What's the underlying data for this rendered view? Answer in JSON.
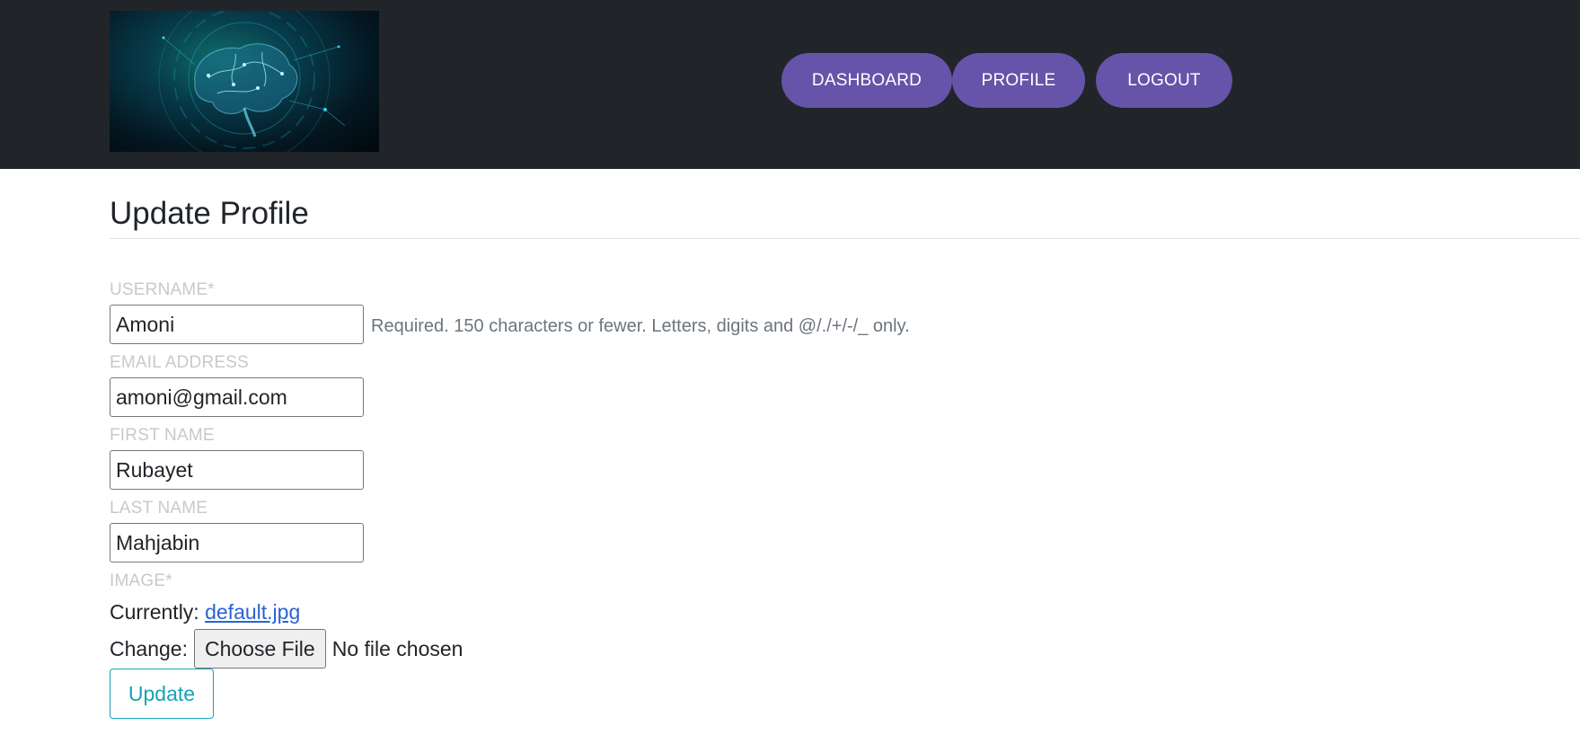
{
  "nav": {
    "items": [
      {
        "label": "DASHBOARD"
      },
      {
        "label": "PROFILE"
      },
      {
        "label": "LOGOUT"
      }
    ]
  },
  "page": {
    "title": "Update Profile"
  },
  "form": {
    "username": {
      "label": "USERNAME*",
      "value": "Amoni",
      "help": "Required. 150 characters or fewer. Letters, digits and @/./+/-/_ only."
    },
    "email": {
      "label": "EMAIL ADDRESS",
      "value": "amoni@gmail.com"
    },
    "first_name": {
      "label": "FIRST NAME",
      "value": "Rubayet"
    },
    "last_name": {
      "label": "LAST NAME",
      "value": "Mahjabin"
    },
    "image": {
      "label": "IMAGE*",
      "currently_label": "Currently:",
      "current_file": "default.jpg",
      "change_label": "Change:",
      "choose_button": "Choose File",
      "no_file_text": "No file chosen"
    },
    "submit_label": "Update"
  },
  "colors": {
    "navbar_bg": "#212529",
    "nav_button_bg": "#6554a9",
    "update_button": "#17a2b8",
    "link": "#2a63d4"
  }
}
